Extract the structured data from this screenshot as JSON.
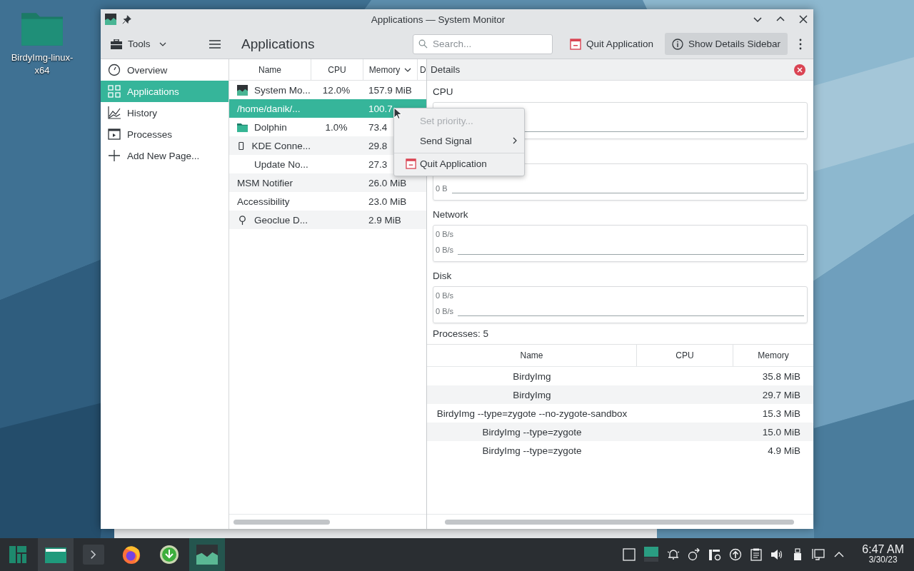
{
  "desktop": {
    "icons": [
      {
        "label": "BirdyImg-linux-x64"
      }
    ]
  },
  "window": {
    "title": "Applications — System Monitor"
  },
  "toolbar": {
    "tools_menu": "Tools",
    "page_title": "Applications",
    "search": {
      "placeholder": "Search..."
    },
    "actions": [
      {
        "label": "Quit Application",
        "kind": "quit",
        "pressed": false
      },
      {
        "label": "Show Details Sidebar",
        "kind": "info",
        "pressed": true
      }
    ]
  },
  "sidebar": {
    "items": [
      {
        "label": "Overview",
        "kind": "overview",
        "selected": false
      },
      {
        "label": "Applications",
        "kind": "applications",
        "selected": true
      },
      {
        "label": "History",
        "kind": "history",
        "selected": false
      },
      {
        "label": "Processes",
        "kind": "processes",
        "selected": false
      },
      {
        "label": "Add New Page...",
        "kind": "add",
        "selected": false
      }
    ]
  },
  "app_table": {
    "columns": [
      {
        "label": "Name",
        "sorted": false
      },
      {
        "label": "CPU",
        "sorted": false
      },
      {
        "label": "Memory",
        "sorted": true
      },
      {
        "label": "D"
      }
    ],
    "rows": [
      {
        "name": "System Mo...",
        "cpu": "12.0%",
        "memory": "157.9 MiB",
        "kind": "sysmon",
        "selected": false
      },
      {
        "name": "/home/danik/...",
        "memory": "100.7",
        "kind": "flush",
        "selected": true
      },
      {
        "name": "Dolphin",
        "cpu": "1.0%",
        "memory": "73.4",
        "kind": "folder",
        "selected": false
      },
      {
        "name": "KDE Conne...",
        "memory": "29.8",
        "kind": "phone",
        "selected": false
      },
      {
        "name": "Update No...",
        "memory": "27.3",
        "kind": "blank",
        "selected": false
      },
      {
        "name": "MSM Notifier",
        "memory": "26.0 MiB",
        "kind": "flush",
        "selected": false
      },
      {
        "name": "Accessibility",
        "memory": "23.0 MiB",
        "kind": "flush",
        "selected": false
      },
      {
        "name": "Geoclue D...",
        "memory": "2.9 MiB",
        "kind": "pin",
        "selected": false
      }
    ]
  },
  "context_menu": {
    "items": [
      {
        "label": "Set priority...",
        "kind": "plain",
        "disabled": true,
        "separator_before": false
      },
      {
        "label": "Send Signal",
        "kind": "submenu",
        "disabled": false,
        "separator_before": false
      },
      {
        "label": "Quit Application",
        "kind": "quit",
        "disabled": false,
        "separator_before": true
      }
    ]
  },
  "details": {
    "title": "Details",
    "sections": [
      {
        "label": "CPU"
      },
      {
        "readings": [
          "0 B"
        ]
      },
      {
        "label": "Network",
        "readings": [
          "0 B/s",
          "0 B/s"
        ]
      },
      {
        "label": "Disk",
        "readings": [
          "0 B/s",
          "0 B/s"
        ]
      }
    ],
    "processes_label": "Processes: 5",
    "process_table": {
      "columns": [
        "Name",
        "CPU",
        "Memory"
      ],
      "rows": [
        {
          "name": "BirdyImg",
          "memory": "35.8 MiB"
        },
        {
          "name": "BirdyImg",
          "memory": "29.7 MiB"
        },
        {
          "name": "BirdyImg --type=zygote --no-zygote-sandbox",
          "memory": "15.3 MiB"
        },
        {
          "name": "BirdyImg --type=zygote",
          "memory": "15.0 MiB"
        },
        {
          "name": "BirdyImg --type=zygote",
          "memory": "4.9 MiB"
        }
      ]
    }
  },
  "taskbar": {
    "items": [
      {
        "kind": "launcher",
        "active": false
      },
      {
        "kind": "files",
        "active": true
      },
      {
        "kind": "terminal",
        "active": false
      },
      {
        "kind": "browser",
        "active": false
      },
      {
        "kind": "download",
        "active": false
      },
      {
        "kind": "sysmon",
        "active": true
      }
    ],
    "clock": {
      "time": "6:47 AM",
      "date": "3/30/23"
    }
  }
}
